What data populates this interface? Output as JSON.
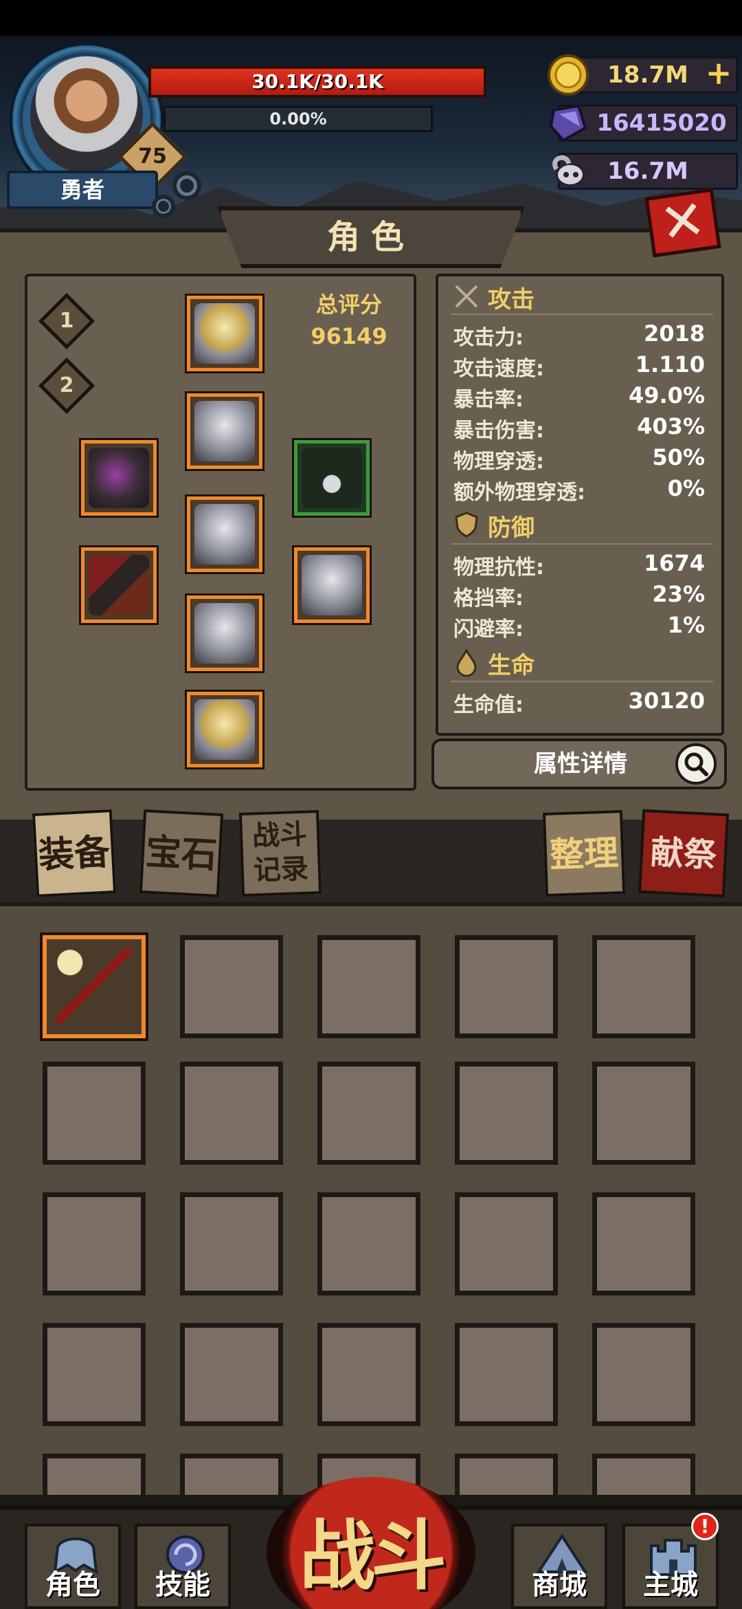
{
  "player": {
    "name": "勇者",
    "level": "75",
    "hp_text": "30.1K/30.1K",
    "exp_text": "0.00%"
  },
  "resources": {
    "gold": "18.7M",
    "gems": "16415020",
    "souls": "16.7M",
    "add_label": "+"
  },
  "panel": {
    "title": "角色",
    "close_label": "✕"
  },
  "equipment": {
    "pages": [
      "1",
      "2"
    ],
    "score_label": "总评分",
    "score_value": "96149"
  },
  "stats": {
    "attack": {
      "title": "攻击",
      "rows": [
        {
          "name": "攻击力:",
          "value": "2018"
        },
        {
          "name": "攻击速度:",
          "value": "1.110"
        },
        {
          "name": "暴击率:",
          "value": "49.0%"
        },
        {
          "name": "暴击伤害:",
          "value": "403%"
        },
        {
          "name": "物理穿透:",
          "value": "50%"
        },
        {
          "name": "额外物理穿透:",
          "value": "0%"
        }
      ]
    },
    "defense": {
      "title": "防御",
      "rows": [
        {
          "name": "物理抗性:",
          "value": "1674"
        },
        {
          "name": "格挡率:",
          "value": "23%"
        },
        {
          "name": "闪避率:",
          "value": "1%"
        }
      ]
    },
    "life": {
      "title": "生命",
      "rows": [
        {
          "name": "生命值:",
          "value": "30120"
        }
      ]
    },
    "detail_label": "属性详情"
  },
  "tabs": {
    "equip": "装备",
    "gem": "宝石",
    "record_line1": "战斗",
    "record_line2": "记录",
    "sort": "整理",
    "sacrifice": "献祭"
  },
  "nav": {
    "character": "角色",
    "skills": "技能",
    "battle": "战斗",
    "shop": "商城",
    "main_city": "主城",
    "badge": "!"
  },
  "colors": {
    "accent_gold": "#f1cf69",
    "hp_red": "#e0321f",
    "slot_orange": "#f0892c",
    "close_red": "#c0201a"
  }
}
